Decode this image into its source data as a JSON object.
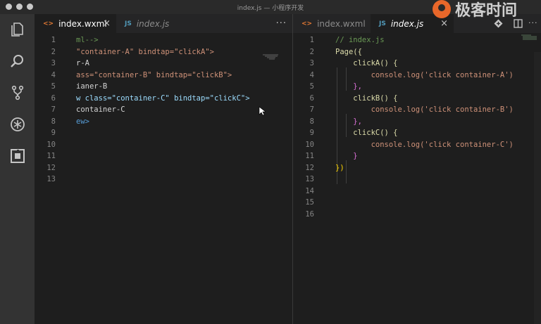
{
  "window": {
    "title": "index.js — 小程序开发"
  },
  "brand": {
    "text": "极客时间"
  },
  "activity_bar": {
    "icons": [
      "files-icon",
      "search-icon",
      "source-control-icon",
      "debug-icon",
      "extensions-icon"
    ]
  },
  "left_pane": {
    "tabs": [
      {
        "icon": "<>",
        "label": "index.wxml",
        "active": true
      },
      {
        "icon": "JS",
        "label": "index.js",
        "active": false
      }
    ],
    "more": "···",
    "close": "×",
    "lines": [
      {
        "n": "1",
        "text": "ml-->"
      },
      {
        "n": "2",
        "text": "\"container-A\" bindtap=\"clickA\">"
      },
      {
        "n": "3",
        "text": "r-A"
      },
      {
        "n": "4",
        "text": "ass=\"container-B\" bindtap=\"clickB\">"
      },
      {
        "n": "5",
        "text": "ianer-B"
      },
      {
        "n": "6",
        "text": "w class=\"container-C\" bindtap=\"clickC\">"
      },
      {
        "n": "7",
        "text": "container-C"
      },
      {
        "n": "8",
        "text": "ew>"
      },
      {
        "n": "9",
        "text": ""
      },
      {
        "n": "10",
        "text": ""
      },
      {
        "n": "11",
        "text": ""
      },
      {
        "n": "12",
        "text": ""
      },
      {
        "n": "13",
        "text": ""
      }
    ]
  },
  "right_pane": {
    "tabs": [
      {
        "icon": "<>",
        "label": "index.wxml",
        "active": false
      },
      {
        "icon": "JS",
        "label": "index.js",
        "active": true
      }
    ],
    "close": "×",
    "toolbar": {
      "more": "···"
    },
    "lines": [
      {
        "n": "1",
        "text": "// index.js"
      },
      {
        "n": "2",
        "text": "Page({"
      },
      {
        "n": "3",
        "text": "    clickA() {"
      },
      {
        "n": "4",
        "text": "        console.log('click container-A')"
      },
      {
        "n": "5",
        "text": "    },"
      },
      {
        "n": "6",
        "text": "    clickB() {"
      },
      {
        "n": "7",
        "text": "        console.log('click container-B')"
      },
      {
        "n": "8",
        "text": "    },"
      },
      {
        "n": "9",
        "text": "    clickC() {"
      },
      {
        "n": "10",
        "text": "        console.log('click container-C')"
      },
      {
        "n": "11",
        "text": "    }"
      },
      {
        "n": "12",
        "text": "})"
      },
      {
        "n": "13",
        "text": ""
      },
      {
        "n": "14",
        "text": ""
      },
      {
        "n": "15",
        "text": ""
      },
      {
        "n": "16",
        "text": ""
      }
    ]
  },
  "colors": {
    "background": "#1e1e1e",
    "string": "#ce9178",
    "attribute": "#9cdcfe",
    "comment": "#6a9955",
    "function": "#dcdcaa",
    "brand": "#e8672a"
  }
}
